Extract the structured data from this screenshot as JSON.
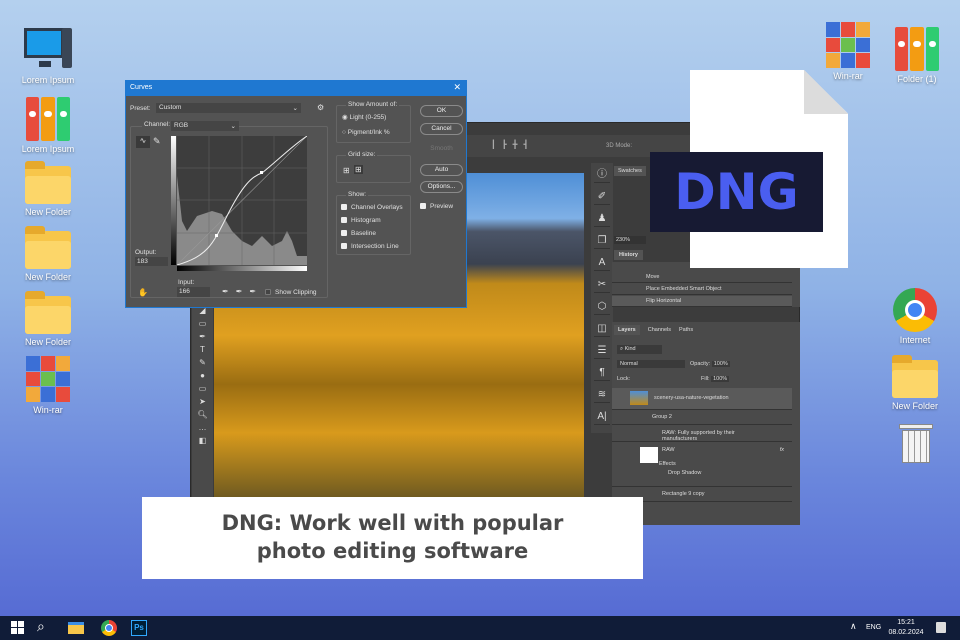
{
  "desktop": {
    "left_icons": [
      "Lorem Ipsum",
      "Lorem Ipsum",
      "New Folder",
      "New Folder",
      "New Folder",
      "Win-rar"
    ],
    "right_icons": [
      "Win-rar",
      "Folder (1)",
      "Internet",
      "New Folder"
    ]
  },
  "curves": {
    "title": "Curves",
    "preset_label": "Preset:",
    "preset_value": "Custom",
    "channel_label": "Channel:",
    "channel_value": "RGB",
    "output_label": "Output:",
    "output_value": "183",
    "input_label": "Input:",
    "input_value": "166",
    "show_clipping": "Show Clipping",
    "show_amount_title": "Show Amount of:",
    "light": "Light  (0-255)",
    "pigment": "Pigment/Ink %",
    "grid_size": "Grid size:",
    "show_title": "Show:",
    "show_options": [
      "Channel Overlays",
      "Histogram",
      "Baseline",
      "Intersection Line"
    ],
    "ok": "OK",
    "cancel": "Cancel",
    "smooth": "Smooth",
    "auto": "Auto",
    "options": "Options...",
    "preview": "Preview"
  },
  "photoshop": {
    "mode_3d": "3D Mode:",
    "swatches": "Swatches",
    "zoom": "230%",
    "history_tab": "History",
    "history": [
      "Move",
      "Place Embedded Smart Object",
      "Flip Horizontal"
    ],
    "layer_tabs": [
      "Layers",
      "Channels",
      "Paths"
    ],
    "kind": "Kind",
    "blend": "Normal",
    "opacity_label": "Opacity:",
    "opacity": "100%",
    "lock_label": "Lock:",
    "fill_label": "Fill:",
    "fill": "100%",
    "layers": [
      "scenery-usa-nature-vegetation",
      "Group 2",
      "RAW: Fully supported by their manufacturers",
      "RAW",
      "Effects",
      "Drop Shadow",
      "Rectangle 9 copy"
    ],
    "fx": "fx"
  },
  "file_icon": {
    "label": "DNG",
    "color": "#4a5ef0"
  },
  "caption": {
    "line1": "DNG: Work well with popular",
    "line2": "photo editing software"
  },
  "taskbar": {
    "lang": "ENG",
    "time": "15:21",
    "date": "08.02.2024",
    "ps": "Ps"
  }
}
